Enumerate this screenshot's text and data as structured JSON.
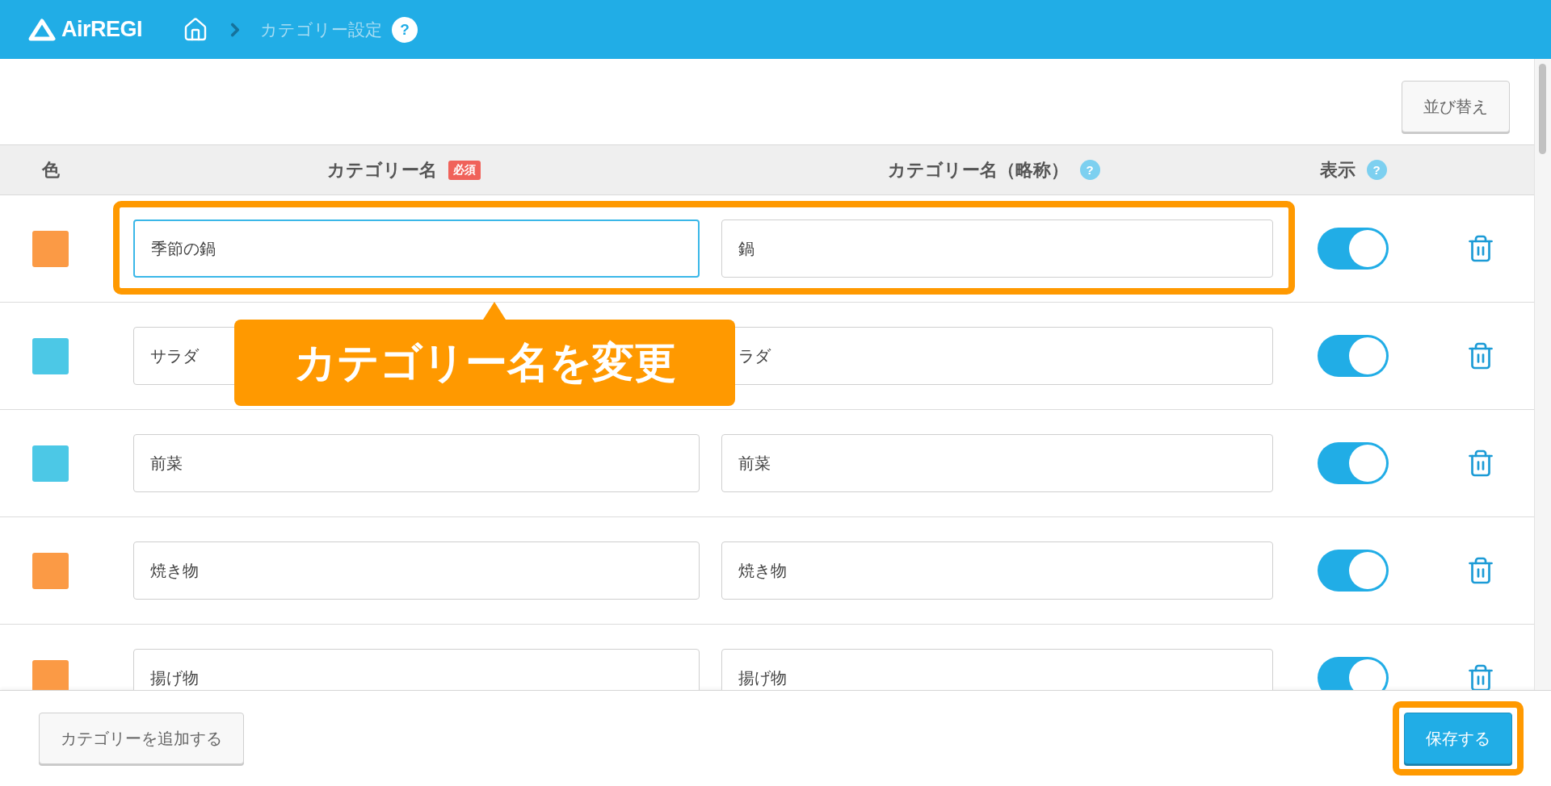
{
  "header": {
    "logo": "AirREGI",
    "breadcrumb": "カテゴリー設定",
    "help": "?"
  },
  "sort_button": "並び替え",
  "table": {
    "columns": [
      {
        "label": "色"
      },
      {
        "label": "カテゴリー名",
        "badge": "必須"
      },
      {
        "label": "カテゴリー名（略称）",
        "help": "?"
      },
      {
        "label": "表示",
        "help": "?"
      }
    ],
    "rows": [
      {
        "color": "#fb9a45",
        "name": "季節の鍋",
        "short": "鍋",
        "visible": true,
        "focused": true
      },
      {
        "color": "#4cc8e6",
        "name": "サラダ",
        "short": "ラダ",
        "visible": true,
        "focused": false
      },
      {
        "color": "#4cc8e6",
        "name": "前菜",
        "short": "前菜",
        "visible": true,
        "focused": false
      },
      {
        "color": "#fb9a45",
        "name": "焼き物",
        "short": "焼き物",
        "visible": true,
        "focused": false
      },
      {
        "color": "#fb9a45",
        "name": "揚げ物",
        "short": "揚げ物",
        "visible": true,
        "focused": false
      }
    ]
  },
  "annotation": "カテゴリー名を変更",
  "footer": {
    "add_button": "カテゴリーを追加する",
    "save_button": "保存する"
  }
}
